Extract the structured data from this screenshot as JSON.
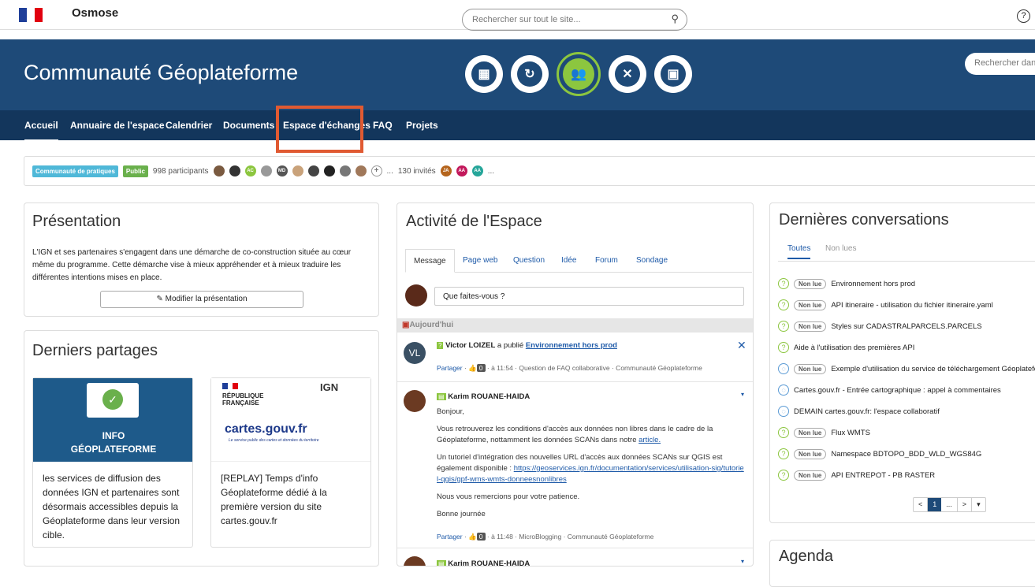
{
  "topbar": {
    "app_name": "Osmose",
    "search_placeholder": "Rechercher sur tout le site..."
  },
  "banner": {
    "title": "Communauté Géoplateforme",
    "search_placeholder": "Rechercher dans c"
  },
  "nav": [
    "Accueil",
    "Annuaire de l'espace",
    "Calendrier",
    "Documents",
    "Espace d'échanges",
    "FAQ",
    "Projets"
  ],
  "members": {
    "badge1": "Communauté de pratiques",
    "badge2": "Public",
    "participants": "998 participants",
    "invites": "130 invités",
    "avatar_initials": [
      "AC",
      "MD",
      "JA",
      "AA",
      "AA"
    ],
    "more": "..."
  },
  "presentation": {
    "title": "Présentation",
    "text": "L'IGN et ses partenaires s'engagent dans une démarche de co-construction située au cœur même du programme. Cette démarche vise à mieux appréhender et à mieux traduire les différentes intentions mises en place.",
    "button": "Modifier la présentation"
  },
  "partages": {
    "title": "Derniers partages",
    "card1_img_line1": "INFO",
    "card1_img_line2": "GÉOPLATEFORME",
    "card1_text": "les services de diffusion des données IGN et partenaires sont désormais accessibles depuis la Géoplateforme dans leur version cible.",
    "card2_img_title": "cartes.gouv.fr",
    "card2_img_sub": "Le service public des cartes et données du territoire",
    "card2_rf": "RÉPUBLIQUE FRANÇAISE",
    "card2_ign": "IGN",
    "card2_text": "[REPLAY] Temps d'info Géoplateforme dédié à la première version du site cartes.gouv.fr"
  },
  "activite": {
    "title": "Activité de l'Espace",
    "tabs": [
      "Message",
      "Page web",
      "Question",
      "Idée",
      "Forum",
      "Sondage"
    ],
    "input_placeholder": "Que faites-vous ?",
    "today": "Aujourd'hui",
    "post1": {
      "avatar": "VL",
      "author": "Victor LOIZEL",
      "verb": "a publié",
      "link": "Environnement hors prod",
      "share": "Partager",
      "count": "0",
      "meta": "à 11:54 · Question de FAQ collaborative · Communauté Géoplateforme"
    },
    "post2": {
      "author": "Karim ROUANE-HAIDA",
      "p1": "Bonjour,",
      "p2": "Vous retrouverez les conditions d'accès aux données non libres dans le cadre de la Géoplateforme, nottamment les données SCANs dans notre",
      "p2link": "article.",
      "p3": "Un tutoriel d'intégration des nouvelles URL d'accès aux données SCANs sur QGIS est également disponible :",
      "p3link": "https://geoservices.ign.fr/documentation/services/utilisation-sig/tutoriel-qgis/gpf-wms-wmts-donneesnonlibres",
      "p4": "Nous vous remercions pour votre patience.",
      "p5": "Bonne journée",
      "share": "Partager",
      "count": "0",
      "meta": "à 11:48 · MicroBlogging · Communauté Géoplateforme"
    },
    "post3_author": "Karim ROUANE-HAIDA"
  },
  "conversations": {
    "title": "Dernières conversations",
    "tabs": [
      "Toutes",
      "Non lues"
    ],
    "nonlue_label": "Non lue",
    "items": [
      {
        "text": "Environnement hors prod",
        "nonlue": true,
        "icon": "q"
      },
      {
        "text": "API itineraire - utilisation du fichier itineraire.yaml",
        "nonlue": true,
        "icon": "q"
      },
      {
        "text": "Styles sur CADASTRALPARCELS.PARCELS",
        "nonlue": true,
        "icon": "q"
      },
      {
        "text": "Aide à l'utilisation des premières API",
        "nonlue": false,
        "icon": "q"
      },
      {
        "text": "Exemple d'utilisation du service de téléchargement Géoplatefor",
        "nonlue": true,
        "icon": "c"
      },
      {
        "text": "Cartes.gouv.fr - Entrée cartographique : appel à commentaires",
        "nonlue": false,
        "icon": "c"
      },
      {
        "text": "DEMAIN cartes.gouv.fr: l'espace collaboratif",
        "nonlue": false,
        "icon": "c"
      },
      {
        "text": "Flux WMTS",
        "nonlue": true,
        "icon": "q"
      },
      {
        "text": "Namespace BDTOPO_BDD_WLD_WGS84G",
        "nonlue": true,
        "icon": "q"
      },
      {
        "text": "API ENTREPOT - PB RASTER",
        "nonlue": true,
        "icon": "q"
      }
    ],
    "pager": [
      "<",
      "1",
      "...",
      ">",
      "▾"
    ]
  },
  "agenda": {
    "title": "Agenda"
  }
}
